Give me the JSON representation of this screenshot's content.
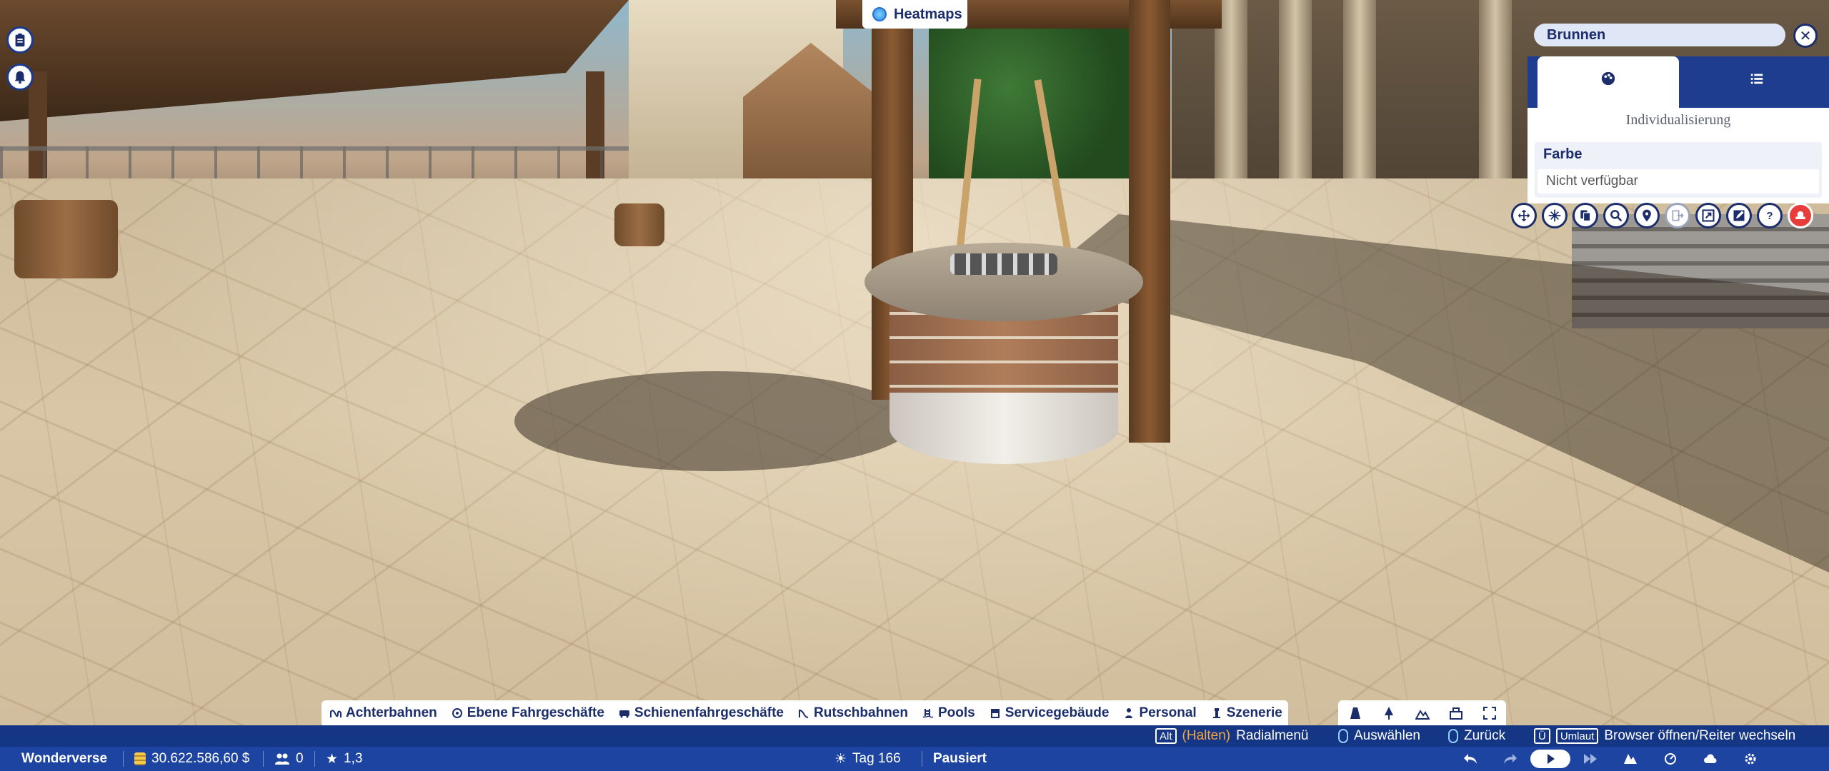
{
  "window": {
    "title": ""
  },
  "top": {
    "heatmaps_label": "Heatmaps"
  },
  "side_icons": [
    {
      "name": "clipboard-icon"
    },
    {
      "name": "notification-bell-icon"
    }
  ],
  "info_panel": {
    "title": "Brunnen",
    "close_icon": "close-icon",
    "tabs": [
      {
        "name": "customize-palette-icon",
        "active": true
      },
      {
        "name": "list-icon",
        "active": false
      }
    ],
    "subtitle": "Individualisierung",
    "section_header": "Farbe",
    "section_value": "Nicht verfügbar"
  },
  "tools": [
    {
      "name": "move-icon"
    },
    {
      "name": "snowflake-freeze-icon"
    },
    {
      "name": "copy-icon"
    },
    {
      "name": "advanced-move-icon"
    },
    {
      "name": "location-pin-icon"
    },
    {
      "name": "exit-icon",
      "disabled": true
    },
    {
      "name": "resize-icon"
    },
    {
      "name": "edit-icon"
    },
    {
      "name": "help-icon"
    },
    {
      "name": "delete-icon",
      "danger": true
    }
  ],
  "categories": [
    {
      "name": "coaster-icon",
      "label": "Achterbahnen"
    },
    {
      "name": "flat-ride-icon",
      "label": "Ebene Fahrgeschäfte"
    },
    {
      "name": "track-ride-icon",
      "label": "Schienenfahrgeschäfte"
    },
    {
      "name": "slide-icon",
      "label": "Rutschbahnen"
    },
    {
      "name": "pool-icon",
      "label": "Pools"
    },
    {
      "name": "shop-icon",
      "label": "Servicegebäude"
    },
    {
      "name": "staff-icon",
      "label": "Personal"
    },
    {
      "name": "scenery-icon",
      "label": "Szenerie"
    }
  ],
  "mini_tools": [
    {
      "name": "path-icon"
    },
    {
      "name": "tree-icon"
    },
    {
      "name": "terrain-icon"
    },
    {
      "name": "blueprint-icon"
    },
    {
      "name": "fullscreen-icon"
    }
  ],
  "hints": {
    "alt_key": "Alt",
    "hold": "(Halten)",
    "radial": "Radialmenü",
    "select": "Auswählen",
    "back": "Zurück",
    "u_key": "Ü",
    "umlaut_key": "Umlaut",
    "browser": "Browser öffnen/Reiter wechseln"
  },
  "status": {
    "park_name": "Wonderverse",
    "money": "30.622.586,60 $",
    "guests": "0",
    "rating": "1,3",
    "day": "Tag 166",
    "state": "Pausiert"
  },
  "colors": {
    "navy": "#1b2d6b",
    "bar_blue": "#1d44a0",
    "hint_blue": "#153685",
    "accent_orange": "#f4a640",
    "danger_red": "#e83d3d"
  }
}
